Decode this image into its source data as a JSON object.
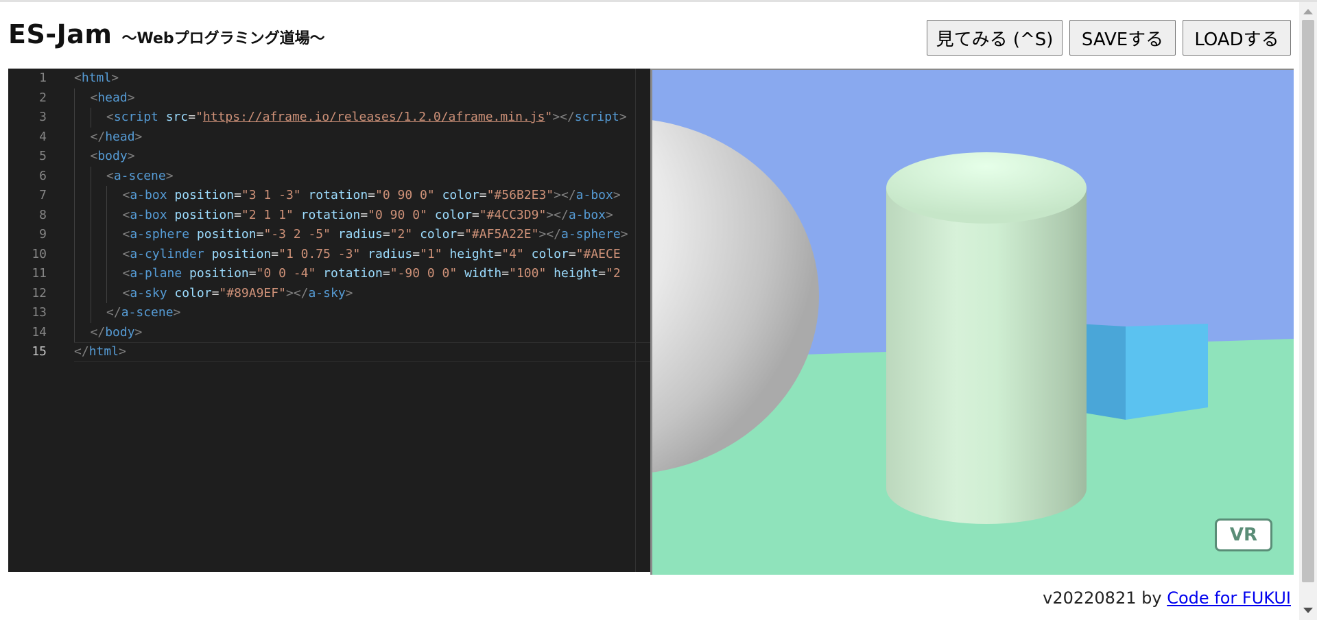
{
  "app": {
    "title": "ES-Jam",
    "subtitle": "〜Webプログラミング道場〜"
  },
  "toolbar": {
    "view_label": "見てみる (^S)",
    "save_label": "SAVEする",
    "load_label": "LOADする"
  },
  "editor": {
    "language": "html",
    "active_line": 15,
    "lines": [
      {
        "n": "1",
        "indent": 0,
        "html": "<span class=\"p\">&lt;</span><span class=\"t\">html</span><span class=\"p\">&gt;</span>"
      },
      {
        "n": "2",
        "indent": 1,
        "html": "<span class=\"p\">&lt;</span><span class=\"t\">head</span><span class=\"p\">&gt;</span>"
      },
      {
        "n": "3",
        "indent": 2,
        "html": "<span class=\"p\">&lt;</span><span class=\"t\">script</span> <span class=\"a\">src</span>=<span class=\"s\">\"</span><span class=\"u\">https://aframe.io/releases/1.2.0/aframe.min.js</span><span class=\"s\">\"</span><span class=\"p\">&gt;&lt;/</span><span class=\"t\">script</span><span class=\"p\">&gt;</span>"
      },
      {
        "n": "4",
        "indent": 1,
        "html": "<span class=\"p\">&lt;/</span><span class=\"t\">head</span><span class=\"p\">&gt;</span>"
      },
      {
        "n": "5",
        "indent": 1,
        "html": "<span class=\"p\">&lt;</span><span class=\"t\">body</span><span class=\"p\">&gt;</span>"
      },
      {
        "n": "6",
        "indent": 2,
        "html": "<span class=\"p\">&lt;</span><span class=\"t\">a-scene</span><span class=\"p\">&gt;</span>"
      },
      {
        "n": "7",
        "indent": 3,
        "html": "<span class=\"p\">&lt;</span><span class=\"t\">a-box</span> <span class=\"a\">position</span>=<span class=\"s\">\"3 1 -3\"</span> <span class=\"a\">rotation</span>=<span class=\"s\">\"0 90 0\"</span> <span class=\"a\">color</span>=<span class=\"s\">\"#56B2E3\"</span><span class=\"p\">&gt;&lt;/</span><span class=\"t\">a-box</span><span class=\"p\">&gt;</span>"
      },
      {
        "n": "8",
        "indent": 3,
        "html": "<span class=\"p\">&lt;</span><span class=\"t\">a-box</span> <span class=\"a\">position</span>=<span class=\"s\">\"2 1 1\"</span> <span class=\"a\">rotation</span>=<span class=\"s\">\"0 90 0\"</span> <span class=\"a\">color</span>=<span class=\"s\">\"#4CC3D9\"</span><span class=\"p\">&gt;&lt;/</span><span class=\"t\">a-box</span><span class=\"p\">&gt;</span>"
      },
      {
        "n": "9",
        "indent": 3,
        "html": "<span class=\"p\">&lt;</span><span class=\"t\">a-sphere</span> <span class=\"a\">position</span>=<span class=\"s\">\"-3 2 -5\"</span> <span class=\"a\">radius</span>=<span class=\"s\">\"2\"</span> <span class=\"a\">color</span>=<span class=\"s\">\"#AF5A22E\"</span><span class=\"p\">&gt;&lt;/</span><span class=\"t\">a-sphere</span><span class=\"p\">&gt;</span>"
      },
      {
        "n": "10",
        "indent": 3,
        "html": "<span class=\"p\">&lt;</span><span class=\"t\">a-cylinder</span> <span class=\"a\">position</span>=<span class=\"s\">\"1 0.75 -3\"</span> <span class=\"a\">radius</span>=<span class=\"s\">\"1\"</span> <span class=\"a\">height</span>=<span class=\"s\">\"4\"</span> <span class=\"a\">color</span>=<span class=\"s\">\"#AECE</span>"
      },
      {
        "n": "11",
        "indent": 3,
        "html": "<span class=\"p\">&lt;</span><span class=\"t\">a-plane</span> <span class=\"a\">position</span>=<span class=\"s\">\"0 0 -4\"</span> <span class=\"a\">rotation</span>=<span class=\"s\">\"-90 0 0\"</span> <span class=\"a\">width</span>=<span class=\"s\">\"100\"</span> <span class=\"a\">height</span>=<span class=\"s\">\"2</span>"
      },
      {
        "n": "12",
        "indent": 3,
        "html": "<span class=\"p\">&lt;</span><span class=\"t\">a-sky</span> <span class=\"a\">color</span>=<span class=\"s\">\"#89A9EF\"</span><span class=\"p\">&gt;&lt;/</span><span class=\"t\">a-sky</span><span class=\"p\">&gt;</span>"
      },
      {
        "n": "13",
        "indent": 2,
        "html": "<span class=\"p\">&lt;/</span><span class=\"t\">a-scene</span><span class=\"p\">&gt;</span>"
      },
      {
        "n": "14",
        "indent": 1,
        "html": "<span class=\"p\">&lt;/</span><span class=\"t\">body</span><span class=\"p\">&gt;</span>"
      },
      {
        "n": "15",
        "indent": 0,
        "html": "<span class=\"p\">&lt;/</span><span class=\"t\">html</span><span class=\"p\">&gt;</span>"
      }
    ]
  },
  "preview": {
    "sky_color": "#89A9EF",
    "ground_color": "#8FE3BB",
    "box_color": "#5BC2F0",
    "vr_label": "VR"
  },
  "footer": {
    "version": "v20220821 by ",
    "link_text": "Code for FUKUI"
  }
}
